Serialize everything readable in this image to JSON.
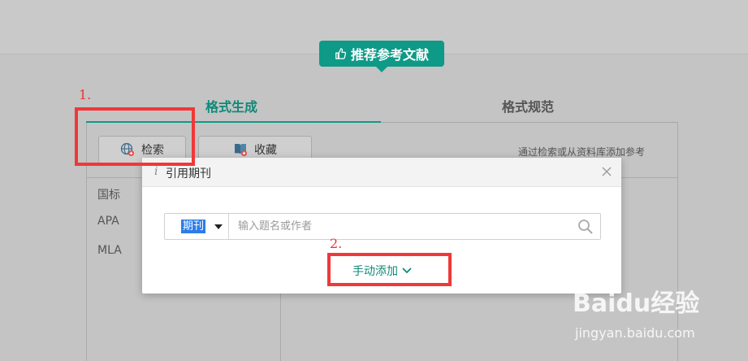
{
  "badge": {
    "label": "推荐参考文献",
    "icon": "thumbs-up-icon"
  },
  "tabs": [
    {
      "label": "格式生成",
      "active": true
    },
    {
      "label": "格式规范",
      "active": false
    }
  ],
  "toolbar": {
    "search_label": "检索",
    "search_icon": "globe-plus-icon",
    "favorites_label": "收藏",
    "favorites_icon": "book-plus-icon",
    "hint": "通过检索或从资料库添加参考"
  },
  "styles": [
    "国标",
    "APA",
    "MLA"
  ],
  "dialog": {
    "title": "引用期刊",
    "type_selected": "期刊",
    "search_placeholder": "输入题名或作者",
    "manual_add_label": "手动添加"
  },
  "annotations": {
    "step1": "1.",
    "step2": "2."
  },
  "watermark": {
    "logo": "Baidu经验",
    "url": "jingyan.baidu.com"
  },
  "colors": {
    "accent": "#0e9a87",
    "annotation": "#f03838",
    "selection": "#2c7de8"
  }
}
